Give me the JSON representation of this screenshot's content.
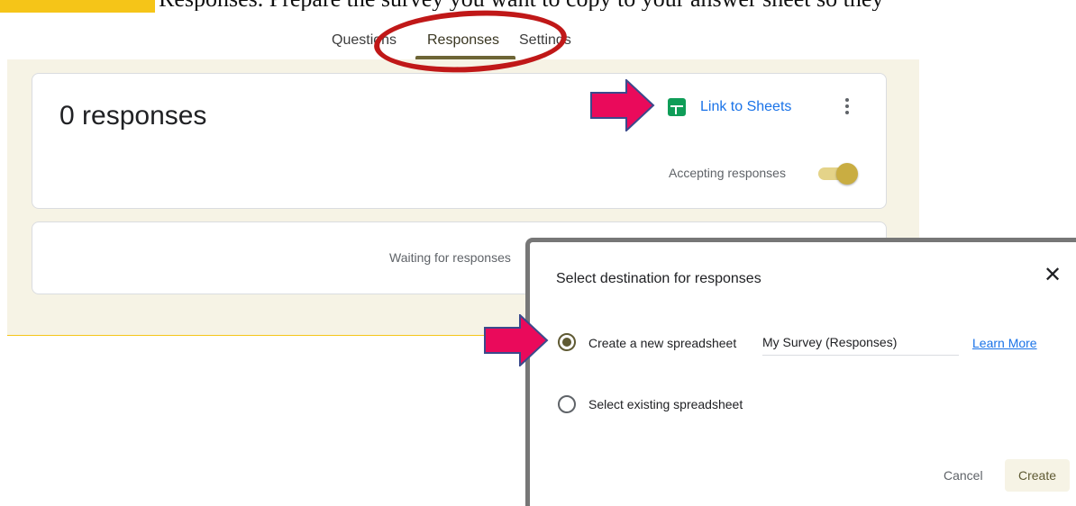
{
  "doc": {
    "text_fragment": "Responses. Prepare the survey you want to copy to your answer sheet so they"
  },
  "tabs": {
    "questions": "Questions",
    "responses": "Responses",
    "settings": "Settings"
  },
  "summary": {
    "count_text": "0 responses",
    "link_to_sheets": "Link to Sheets",
    "more_options_icon": "more-vert-icon",
    "accepting_label": "Accepting responses",
    "accepting_on": true
  },
  "waiting": {
    "text": "Waiting for responses"
  },
  "dialog": {
    "title": "Select destination for responses",
    "close_icon": "close-icon",
    "options": {
      "create_new": "Create a new spreadsheet",
      "select_existing": "Select existing spreadsheet"
    },
    "selected_option": "create_new",
    "spreadsheet_name": "My Survey (Responses)",
    "learn_more": "Learn More",
    "cancel": "Cancel",
    "create": "Create"
  },
  "colors": {
    "accent": "#5f5a33",
    "tab_underline": "#6d6536",
    "canvas": "#f6f3e5",
    "sheets_green": "#0f9d58",
    "link_blue": "#1a73e8",
    "annotation_red": "#c01818",
    "annotation_arrow": "#ea0a5b"
  }
}
